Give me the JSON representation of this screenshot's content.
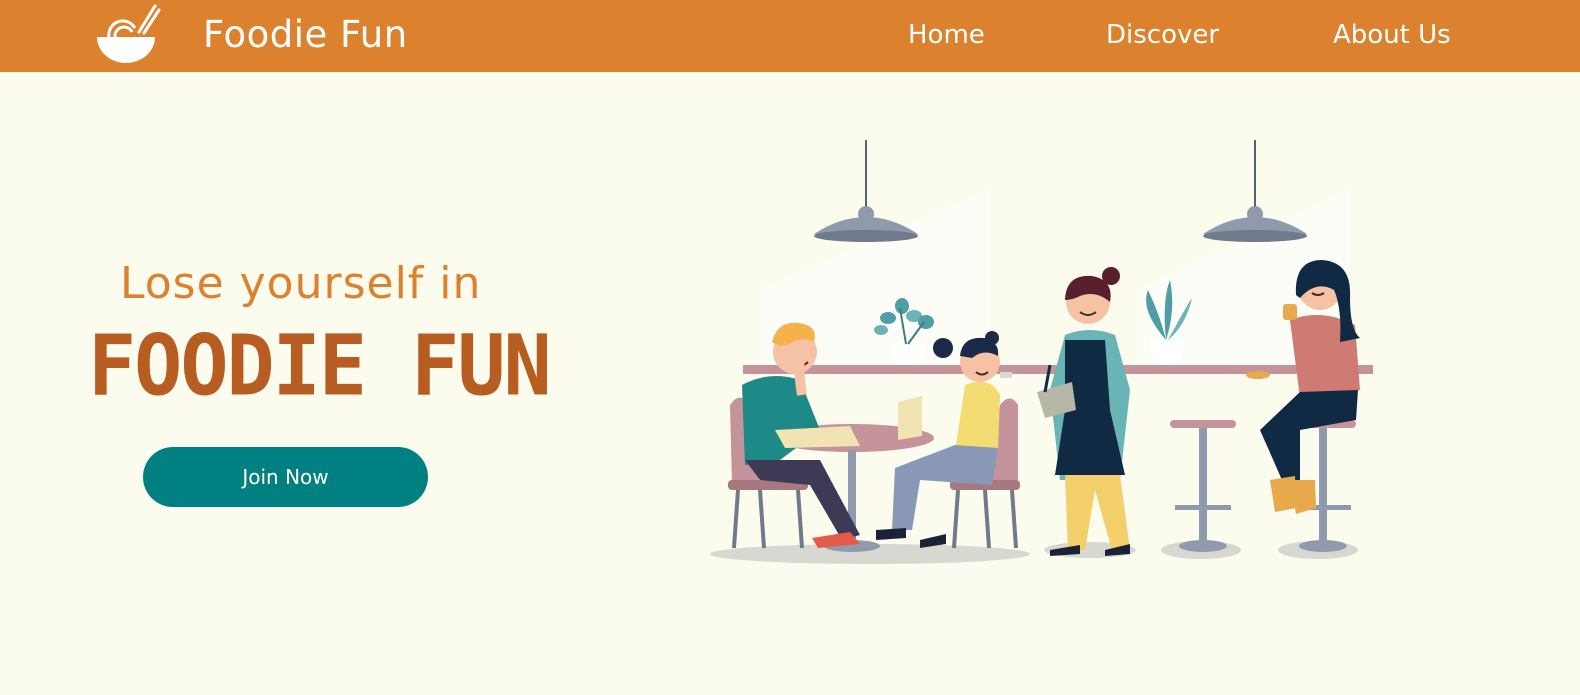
{
  "header": {
    "brand": "Foodie Fun",
    "logo_icon": "noodle-bowl-icon",
    "nav": {
      "home": "Home",
      "discover": "Discover",
      "about": "About Us"
    }
  },
  "hero": {
    "subtitle": "Lose yourself in",
    "title": "FOODIE FUN",
    "cta": "Join Now",
    "illustration": "cafe-scene-illustration"
  },
  "colors": {
    "navbar": "#dc822f",
    "background": "#fbfbee",
    "title": "#b85d21",
    "button": "#008080"
  }
}
